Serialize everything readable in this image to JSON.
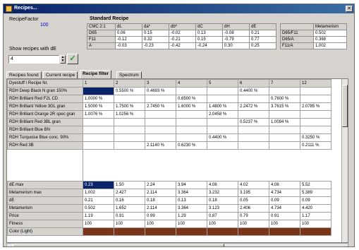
{
  "window": {
    "title": "Recipes..."
  },
  "recipe_factor": {
    "label": "RecipeFactor",
    "value": "100"
  },
  "show_recipes": {
    "label": "Show recipes with dE",
    "value": "4"
  },
  "standard": {
    "title": "Standard   Recipe",
    "headers": [
      "CMC 2:1",
      "dL",
      "da*",
      "db*",
      "dC",
      "dH",
      "dE"
    ],
    "rows": [
      [
        "D65",
        "0.06",
        "0.15",
        "-0.02",
        "0.13",
        "-0.08",
        "0.21"
      ],
      [
        "F11",
        "-0.12",
        "0.32",
        "-0.21",
        "0.15",
        "-0.79",
        "0.77"
      ],
      [
        "A",
        "-0.03",
        "-0.23",
        "-0.42",
        "-0.24",
        "0.30",
        "0.25"
      ]
    ],
    "mi_header": "Metamerism",
    "mi_rows": [
      [
        "D65/F11",
        "0.502"
      ],
      [
        "D65/A",
        "0.368"
      ],
      [
        "F11/A",
        "1.002"
      ]
    ]
  },
  "tabs": [
    "Recipes found",
    "Current recipe",
    "Recipe filter",
    "Spectrum"
  ],
  "grid": {
    "header": [
      "Dyestuff \\ Recipe Nr.",
      "1",
      "2",
      "3",
      "4",
      "5",
      "6",
      "7",
      "12"
    ],
    "dye_rows": [
      [
        "RDH Deep Black N gran 150%",
        "",
        "0.5500 %",
        "0.4693 %",
        "",
        "",
        "0.4400 %",
        "",
        ""
      ],
      [
        "RDH Brilliant Red F2L CD",
        "1.0000 %",
        "",
        "",
        "0.6500 %",
        "",
        "",
        "0.7600 %",
        ""
      ],
      [
        "RDH Brilliant Yellow 3GL gran",
        "1.5000 %",
        "1.7500 %",
        "2.7450 %",
        "1.6000 %",
        "1.4800 %",
        "2.2472 %",
        "3.7615 %",
        "2.0785 %"
      ],
      [
        "RDH Brilliant Orange 2R spec gran",
        "1.0076 %",
        "1.0256 %",
        "",
        "",
        "2.0458 %",
        "",
        "",
        ""
      ],
      [
        "RDH Brilliant Red 3BL gran",
        "",
        "",
        "",
        "",
        "",
        "0.5237 %",
        "1.0094 %",
        ""
      ],
      [
        "RDH Brilliant Blue BN",
        "",
        "",
        "",
        "",
        "",
        "",
        "",
        ""
      ],
      [
        "RDH Turquoise Blue conc. 90%",
        "",
        "",
        "",
        "",
        "0.4400 %",
        "",
        "",
        "0.3250 %"
      ],
      [
        "RDH Red 3B",
        "",
        "",
        "2.1140 %",
        "0.6230 %",
        "",
        "",
        "",
        "0.2111 %"
      ]
    ],
    "stats_rows": [
      [
        "dE max",
        "0.23",
        "1.50",
        "2.24",
        "3.94",
        "4.06",
        "4.02",
        "4.06",
        "5.52"
      ],
      [
        "Metamerism max",
        "1.002",
        "2.427",
        "2.114",
        "3.364",
        "3.232",
        "3.195",
        "4.734",
        "5.389"
      ],
      [
        "dE",
        "0.21",
        "0.16",
        "0.18",
        "0.13",
        "0.18",
        "0.05",
        "0.09",
        "0.09"
      ],
      [
        "Metamerism",
        "0.502",
        "1.652",
        "2.114",
        "3.364",
        "3.123",
        "2.406",
        "4.734",
        "4.420"
      ],
      [
        "Price",
        "1.19",
        "0.91",
        "0.99",
        "1.29",
        "0.87",
        "0.79",
        "0.91",
        "1.17"
      ],
      [
        "Fitness",
        "100",
        "100",
        "100",
        "100",
        "100",
        "100",
        "100",
        "100"
      ],
      [
        "Color (Light)",
        "",
        "",
        "",
        "",
        "",
        "",
        "",
        ""
      ]
    ]
  },
  "colors": {
    "accent": "#0a246a",
    "swatch": "#7a3418"
  }
}
